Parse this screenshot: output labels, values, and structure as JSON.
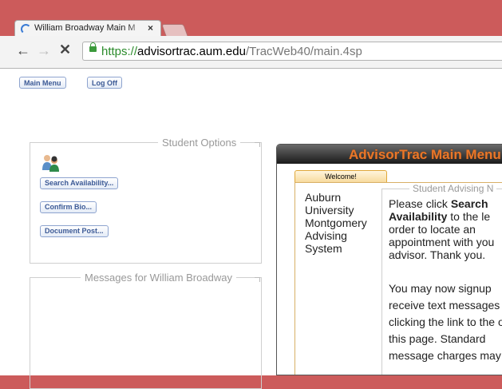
{
  "browser": {
    "tab": {
      "title": "William Broadway Main M",
      "close_label": "×"
    },
    "url": {
      "scheme": "https://",
      "host": "advisortrac.aum.edu",
      "path": "/TracWeb40/main.4sp"
    },
    "nav": {
      "back": "←",
      "forward": "→",
      "stop": "✕"
    }
  },
  "top_buttons": {
    "main_menu": "Main Menu",
    "log_off": "Log Off"
  },
  "student_options": {
    "legend": "Student Options",
    "buttons": {
      "search": "Search Availability...",
      "confirm": "Confirm Bio...",
      "document": "Document Post..."
    }
  },
  "messages": {
    "legend": "Messages for William Broadway"
  },
  "advisortrac": {
    "title": "AdvisorTrac Main Menu",
    "welcome_tab": "Welcome!",
    "school_name": "Auburn University Montgomery Advising System",
    "advising_legend": "Student Advising N",
    "message1": {
      "pre": "Please click ",
      "bold": "Search Availability",
      "post": " to the le order to locate an appointment with you advisor. Thank you."
    },
    "message2": "You may now signup receive text messages clicking the link to the on this page. Standard message charges may"
  },
  "colors": {
    "frame": "#cc5b5b",
    "accent_orange": "#e9772a",
    "button_blue": "#3c5a96"
  }
}
